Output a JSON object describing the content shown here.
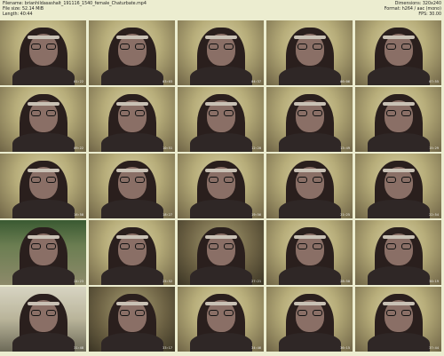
{
  "header": {
    "filename": "Filename: brianhildasashalt_191116_1540_female_Chaturbate.mp4",
    "filesize": "File size: 52.14 MiB",
    "length": "Length: 40:44",
    "dimensions": "Dimensions: 320x240",
    "format": "Format: h264 / aac (mono)",
    "fps": "FPS: 30.00"
  },
  "thumbnails": [
    {
      "time": "01:22",
      "style": "normal"
    },
    {
      "time": "03:03",
      "style": "normal"
    },
    {
      "time": "04:37",
      "style": "normal"
    },
    {
      "time": "06:06",
      "style": "normal"
    },
    {
      "time": "07:55",
      "style": "normal"
    },
    {
      "time": "09:22",
      "style": "normal"
    },
    {
      "time": "10:51",
      "style": "normal"
    },
    {
      "time": "12:20",
      "style": "normal"
    },
    {
      "time": "13:49",
      "style": "normal"
    },
    {
      "time": "15:29",
      "style": "normal"
    },
    {
      "time": "16:58",
      "style": "normal"
    },
    {
      "time": "18:27",
      "style": "normal"
    },
    {
      "time": "19:56",
      "style": "normal"
    },
    {
      "time": "21:25",
      "style": "normal"
    },
    {
      "time": "22:54",
      "style": "normal"
    },
    {
      "time": "24:23",
      "style": "green"
    },
    {
      "time": "25:52",
      "style": "normal"
    },
    {
      "time": "27:21",
      "style": "dark"
    },
    {
      "time": "28:50",
      "style": "normal"
    },
    {
      "time": "30:19",
      "style": "normal"
    },
    {
      "time": "31:48",
      "style": "room"
    },
    {
      "time": "33:17",
      "style": "dark"
    },
    {
      "time": "34:46",
      "style": "normal"
    },
    {
      "time": "36:15",
      "style": "normal"
    },
    {
      "time": "37:44",
      "style": "normal"
    }
  ]
}
